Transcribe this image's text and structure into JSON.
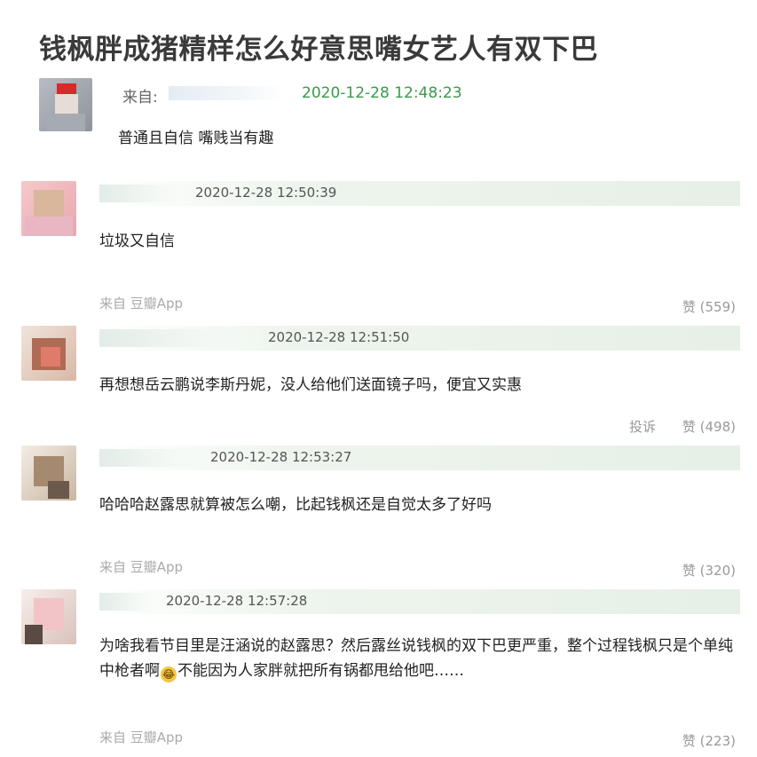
{
  "title": "钱枫胖成猪精样怎么好意思嘴女艺人有双下巴",
  "op": {
    "from_label": "来自:",
    "time": "2020-12-28 12:48:23",
    "text": "普通且自信 嘴贱当有趣"
  },
  "comments": [
    {
      "time": "2020-12-28 12:50:39",
      "text": "垃圾又自信",
      "from": "来自 豆瓣App",
      "like": "赞 (559)"
    },
    {
      "time": "2020-12-28 12:51:50",
      "text": "再想想岳云鹏说李斯丹妮，没人给他们送面镜子吗，便宜又实惠",
      "report": "投诉",
      "like": "赞 (498)"
    },
    {
      "time": "2020-12-28 12:53:27",
      "text": "哈哈哈赵露思就算被怎么嘲，比起钱枫还是自觉太多了好吗",
      "from": "来自 豆瓣App",
      "like": "赞 (320)"
    },
    {
      "time": "2020-12-28 12:57:28",
      "text_before_emoji": "为啥我看节目里是汪涵说的赵露思？然后露丝说钱枫的双下巴更严重，整个过程钱枫只是个单纯中枪者啊",
      "emoji": "😂",
      "text_after_emoji": "不能因为人家胖就把所有锅都甩给他吧……",
      "from": "来自 豆瓣App",
      "like": "赞 (223)"
    }
  ]
}
